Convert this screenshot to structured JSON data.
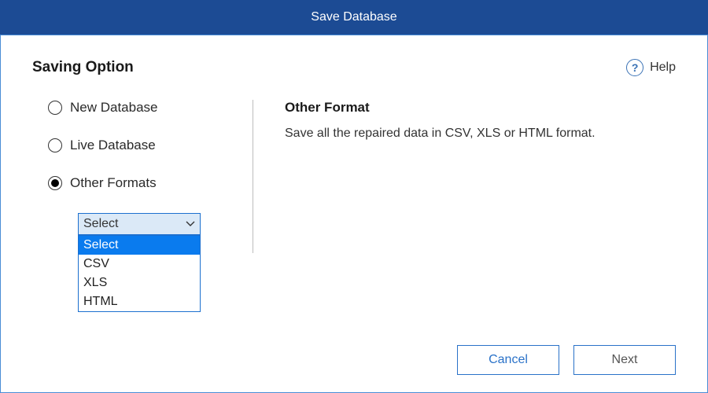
{
  "title": "Save Database",
  "section_title": "Saving Option",
  "help_label": "Help",
  "help_glyph": "?",
  "radios": {
    "new_db": "New Database",
    "live_db": "Live Database",
    "other": "Other Formats"
  },
  "dropdown": {
    "selected": "Select",
    "options": [
      "Select",
      "CSV",
      "XLS",
      "HTML"
    ]
  },
  "right": {
    "title": "Other Format",
    "description": "Save all the repaired data in CSV, XLS or HTML format."
  },
  "buttons": {
    "cancel": "Cancel",
    "next": "Next"
  }
}
